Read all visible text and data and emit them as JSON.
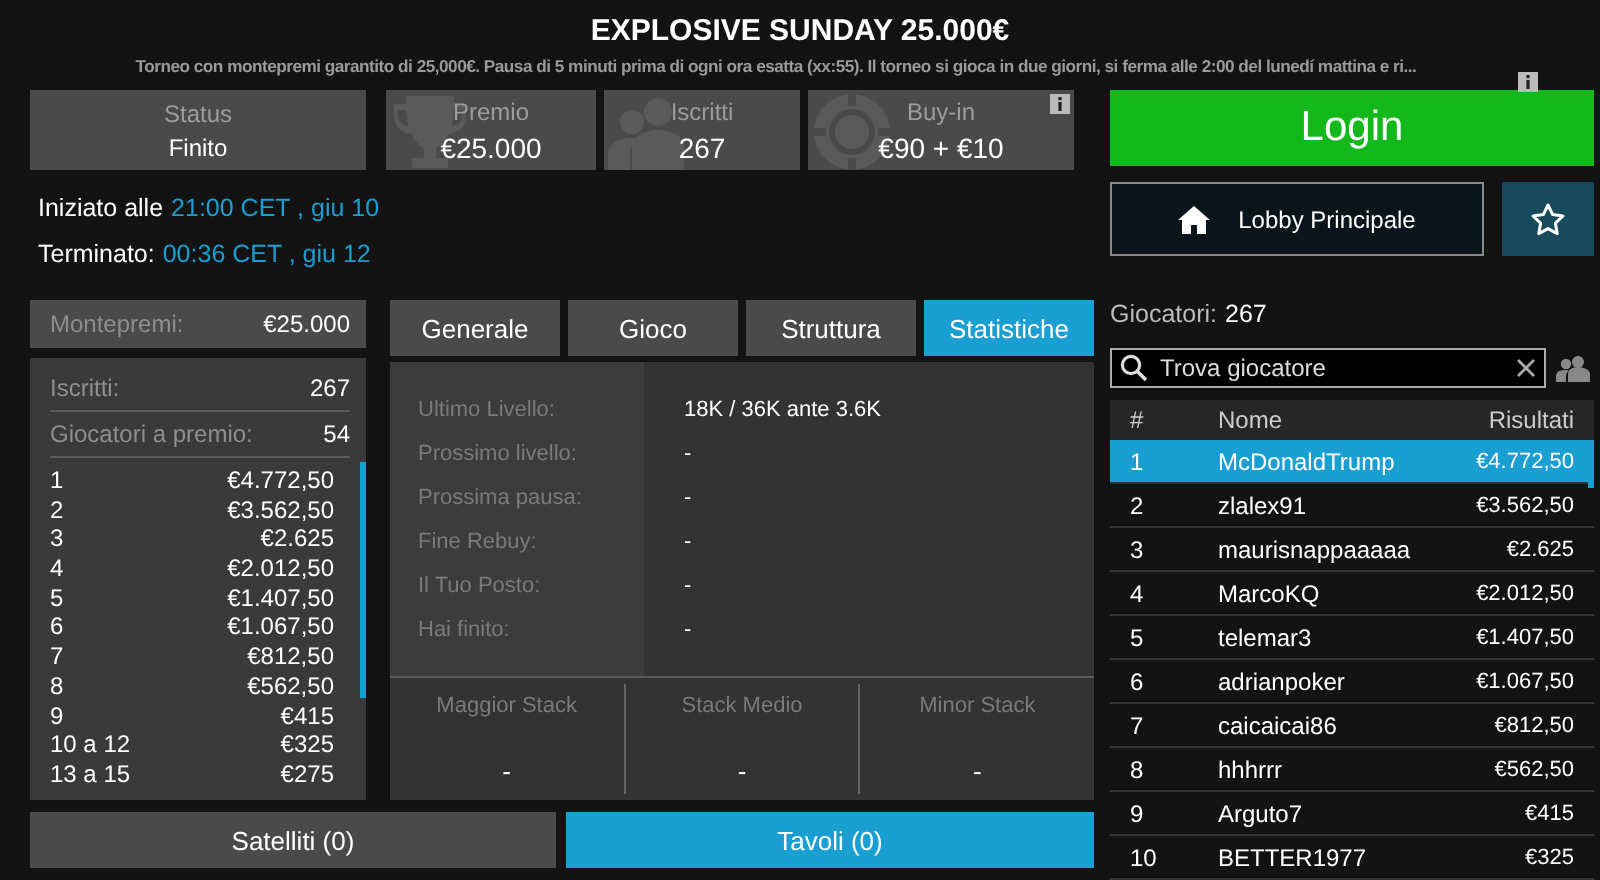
{
  "header": {
    "title": "EXPLOSIVE SUNDAY 25.000€",
    "description": "Torneo con montepremi garantito di 25,000€. Pausa di 5 minuti prima di ogni ora esatta (xx:55). Il torneo si gioca in due giorni, si ferma alle 2:00 del lunedí mattina e ri..."
  },
  "stats": [
    {
      "kind": "status",
      "label": "Status",
      "value": "Finito",
      "info": false
    },
    {
      "kind": "trophy",
      "label": "Premio",
      "value": "€25.000",
      "info": false
    },
    {
      "kind": "players",
      "label": "Iscritti",
      "value": "267",
      "info": false
    },
    {
      "kind": "chip",
      "label": "Buy-in",
      "value": "€90 + €10",
      "info": true
    }
  ],
  "times": [
    {
      "label": "Iniziato alle",
      "value": "21:00 CET , giu 10"
    },
    {
      "label": "Terminato:",
      "value": "00:36 CET , giu 12"
    }
  ],
  "prize_pool": {
    "label": "Montepremi:",
    "value": "€25.000"
  },
  "prize_info": [
    {
      "label": "Iscritti:",
      "value": "267"
    },
    {
      "label": "Giocatori a premio:",
      "value": "54"
    }
  ],
  "payouts": [
    {
      "place": "1",
      "amount": "€4.772,50"
    },
    {
      "place": "2",
      "amount": "€3.562,50"
    },
    {
      "place": "3",
      "amount": "€2.625"
    },
    {
      "place": "4",
      "amount": "€2.012,50"
    },
    {
      "place": "5",
      "amount": "€1.407,50"
    },
    {
      "place": "6",
      "amount": "€1.067,50"
    },
    {
      "place": "7",
      "amount": "€812,50"
    },
    {
      "place": "8",
      "amount": "€562,50"
    },
    {
      "place": "9",
      "amount": "€415"
    },
    {
      "place": "10 a 12",
      "amount": "€325"
    },
    {
      "place": "13 a 15",
      "amount": "€275"
    }
  ],
  "tabs": [
    {
      "label": "Generale",
      "selected": false
    },
    {
      "label": "Gioco",
      "selected": false
    },
    {
      "label": "Struttura",
      "selected": false
    },
    {
      "label": "Statistiche",
      "selected": true
    }
  ],
  "statistics": [
    {
      "label": "Ultimo Livello:",
      "value": "18K / 36K ante 3.6K"
    },
    {
      "label": "Prossimo livello:",
      "value": "-"
    },
    {
      "label": "Prossima pausa:",
      "value": "-"
    },
    {
      "label": "Fine Rebuy:",
      "value": "-"
    },
    {
      "label": "Il Tuo Posto:",
      "value": "-"
    },
    {
      "label": "Hai finito:",
      "value": "-"
    }
  ],
  "stacks": [
    {
      "label": "Maggior Stack",
      "value": "-"
    },
    {
      "label": "Stack Medio",
      "value": "-"
    },
    {
      "label": "Minor Stack",
      "value": "-"
    }
  ],
  "bottom_tabs": [
    {
      "label": "Satelliti (0)",
      "selected": false
    },
    {
      "label": "Tavoli (0)",
      "selected": true
    }
  ],
  "login_button": "Login",
  "lobby_button": "Lobby Principale",
  "players": {
    "label": "Giocatori:",
    "count": "267"
  },
  "search": {
    "placeholder": "Trova giocatore"
  },
  "table": {
    "columns": [
      "#",
      "Nome",
      "Risultati"
    ],
    "rows": [
      {
        "rank": "1",
        "name": "McDonaldTrump",
        "result": "€4.772,50",
        "selected": true
      },
      {
        "rank": "2",
        "name": "zlalex91",
        "result": "€3.562,50",
        "selected": false
      },
      {
        "rank": "3",
        "name": "maurisnappaaaaa",
        "result": "€2.625",
        "selected": false
      },
      {
        "rank": "4",
        "name": "MarcoKQ",
        "result": "€2.012,50",
        "selected": false
      },
      {
        "rank": "5",
        "name": "telemar3",
        "result": "€1.407,50",
        "selected": false
      },
      {
        "rank": "6",
        "name": "adrianpoker",
        "result": "€1.067,50",
        "selected": false
      },
      {
        "rank": "7",
        "name": "caicaicai86",
        "result": "€812,50",
        "selected": false
      },
      {
        "rank": "8",
        "name": "hhhrrr",
        "result": "€562,50",
        "selected": false
      },
      {
        "rank": "9",
        "name": "Arguto7",
        "result": "€415",
        "selected": false
      },
      {
        "rank": "10",
        "name": "BETTER1977",
        "result": "€325",
        "selected": false
      }
    ]
  }
}
